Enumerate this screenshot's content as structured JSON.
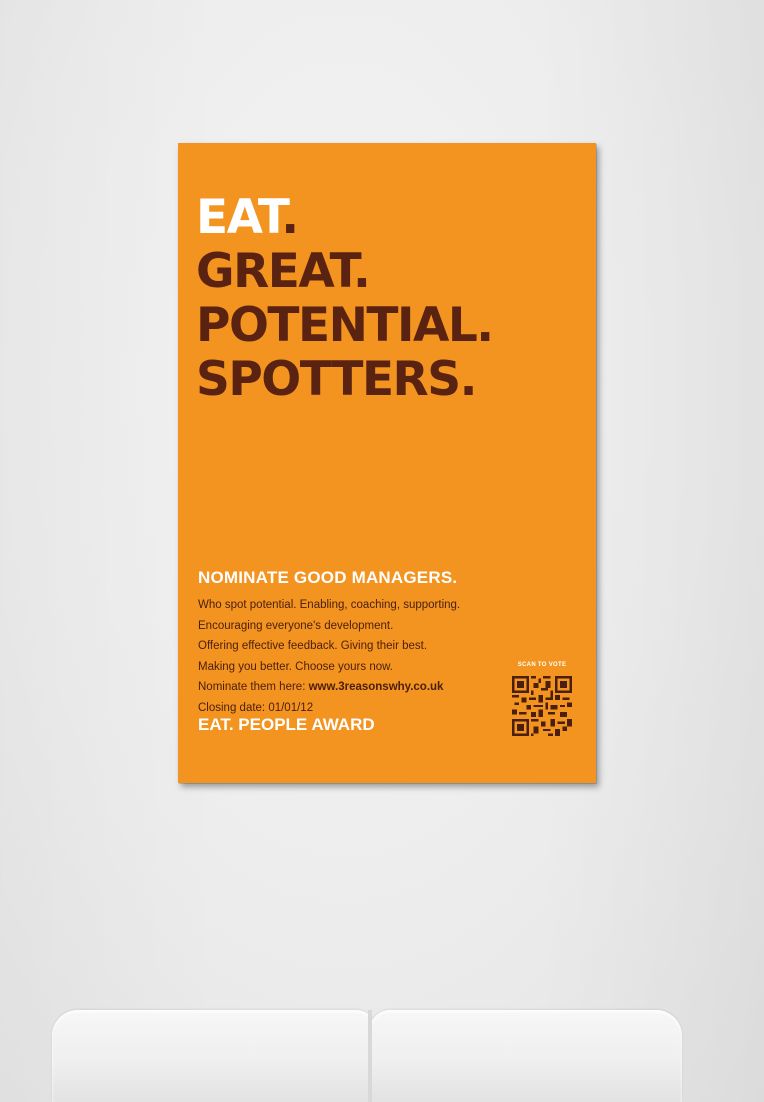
{
  "poster": {
    "headline": {
      "line1": "EAT",
      "line2": "GREAT.",
      "line3": "POTENTIAL.",
      "line4": "SPOTTERS."
    },
    "subheading": "NOMINATE GOOD MANAGERS.",
    "body": {
      "line1": "Who spot potential. Enabling, coaching, supporting.",
      "line2": "Encouraging everyone's development.",
      "line3": "Offering effective feedback. Giving their best.",
      "line4": "Making you better. Choose yours now.",
      "nominate_prefix": "Nominate them here: ",
      "nominate_url": "www.3reasonswhy.co.uk",
      "closing": "Closing date: 01/01/12"
    },
    "award": "EAT. PEOPLE AWARD",
    "qr_label": "SCAN TO VOTE"
  },
  "colors": {
    "poster_orange": "#f39320",
    "headline_brown": "#5a2210",
    "white_text": "#ffffff",
    "wall": "#ececec",
    "chair": "#f2f2f2"
  }
}
